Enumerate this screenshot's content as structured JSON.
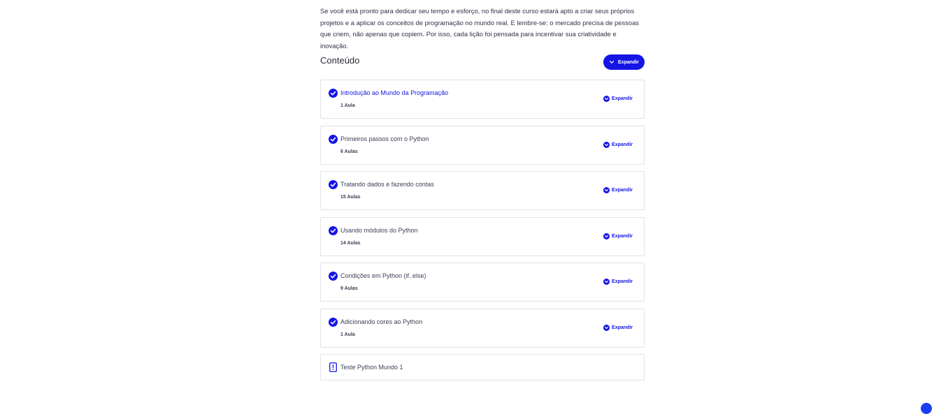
{
  "intro": {
    "text": "Se você está pronto para dedicar seu tempo e esforço, no final deste curso estará apto a criar seus próprios projetos e a aplicar os conceitos de programação no mundo real. E lembre-se: o mercado precisa de pessoas que criem, não apenas que copiem. Por isso, cada lição foi pensada para incentivar sua criatividade e inovação."
  },
  "content": {
    "title": "Conteúdo",
    "expand_all_label": "Expandir"
  },
  "modules": [
    {
      "name": "Introdução ao Mundo da Programação",
      "lessons": "1 Aula",
      "expand_label": "Expandir",
      "completed": true,
      "active": true
    },
    {
      "name": "Primeiros passos com o Python",
      "lessons": "6 Aulas",
      "expand_label": "Expandir",
      "completed": true,
      "active": false
    },
    {
      "name": "Tratando dados e fazendo contas",
      "lessons": "15 Aulas",
      "expand_label": "Expandir",
      "completed": true,
      "active": false
    },
    {
      "name": "Usando módulos do Python",
      "lessons": "14 Aulas",
      "expand_label": "Expandir",
      "completed": true,
      "active": false
    },
    {
      "name": "Condições em Python (if..else)",
      "lessons": "9 Aulas",
      "expand_label": "Expandir",
      "completed": true,
      "active": false
    },
    {
      "name": "Adicionando cores ao Python",
      "lessons": "1 Aula",
      "expand_label": "Expandir",
      "completed": true,
      "active": false
    }
  ],
  "test": {
    "name": "Teste Python Mundo 1",
    "icon": "test-document-icon"
  },
  "colors": {
    "accent": "#1515e6",
    "border": "#e1e2ea",
    "text": "#3d4155"
  }
}
